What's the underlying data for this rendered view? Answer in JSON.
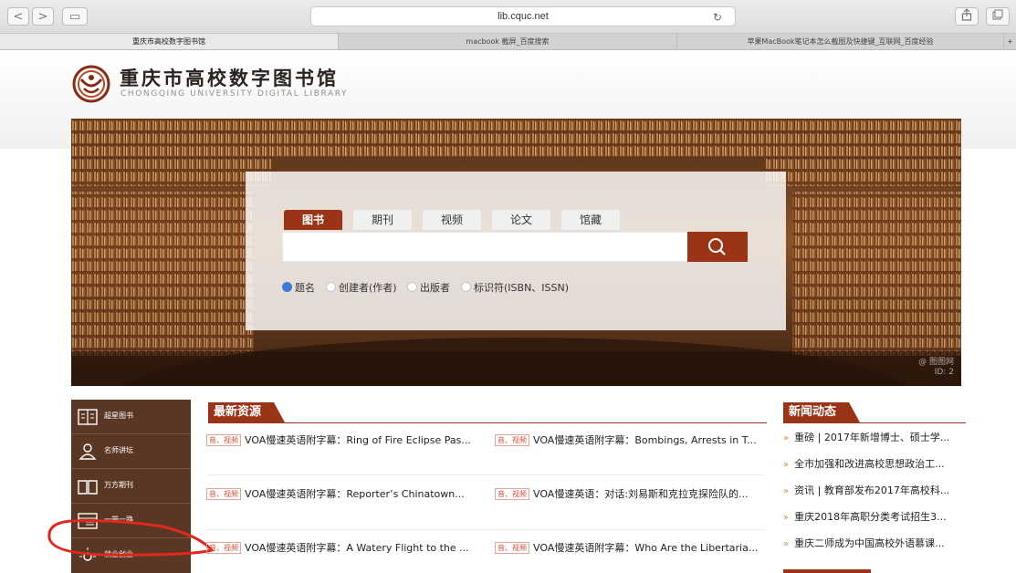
{
  "browser": {
    "back": "<",
    "forward": ">",
    "sidebar_toggle": "▭",
    "url": "lib.cquc.net",
    "tabs": [
      {
        "label": "重庆市高校数字图书馆",
        "active": true
      },
      {
        "label": "macbook 截屏_百度搜索",
        "active": false
      },
      {
        "label": "苹果MacBook笔记本怎么截图及快捷键_互联网_百度经验",
        "active": false
      }
    ],
    "new_tab": "+"
  },
  "header": {
    "title": "重庆市高校数字图书馆",
    "subtitle": "CHONGQING UNIVERSITY DIGITAL LIBRARY"
  },
  "search": {
    "tabs": [
      "图书",
      "期刊",
      "视频",
      "论文",
      "馆藏"
    ],
    "active_tab": "图书",
    "options": [
      "题名",
      "创建者(作者)",
      "出版者",
      "标识符(ISBN、ISSN)"
    ],
    "selected_option": "题名",
    "watermark": [
      "@ 图图网",
      "ID: 2"
    ]
  },
  "sidebar": {
    "items": [
      {
        "label": "超星图书",
        "icon": "book-icon"
      },
      {
        "label": "名师讲坛",
        "icon": "lecturer-icon"
      },
      {
        "label": "万方期刊",
        "icon": "open-book-icon"
      },
      {
        "label": "一带一路",
        "icon": "document-list-icon"
      },
      {
        "label": "就业创业",
        "icon": "lightbulb-icon"
      }
    ]
  },
  "resources": {
    "heading": "最新资源",
    "tag": "音、视频",
    "items": [
      "VOA慢速英语附字幕：Ring of Fire Eclipse Pas...",
      "VOA慢速英语附字幕：Bombings, Arrests in T...",
      "VOA慢速英语附字幕：Reporter’s Chinatown...",
      "VOA慢速英语：对话:刘易斯和克拉克探险队的...",
      "VOA慢速英语附字幕：A Watery Flight to the ...",
      "VOA慢速英语附字幕：Who Are the Libertaria..."
    ]
  },
  "news": {
    "heading": "新闻动态",
    "items": [
      "重磅 | 2017年新增博士、硕士学...",
      "全市加强和改进高校思想政治工...",
      "资讯 | 教育部发布2017年高校科...",
      "重庆2018年高职分类考试招生3...",
      "重庆二师成为中国高校外语慕课..."
    ]
  },
  "colors": {
    "brand": "#9b3417",
    "sidebar_bg": "#5a3724",
    "annotation": "#e0291c"
  }
}
